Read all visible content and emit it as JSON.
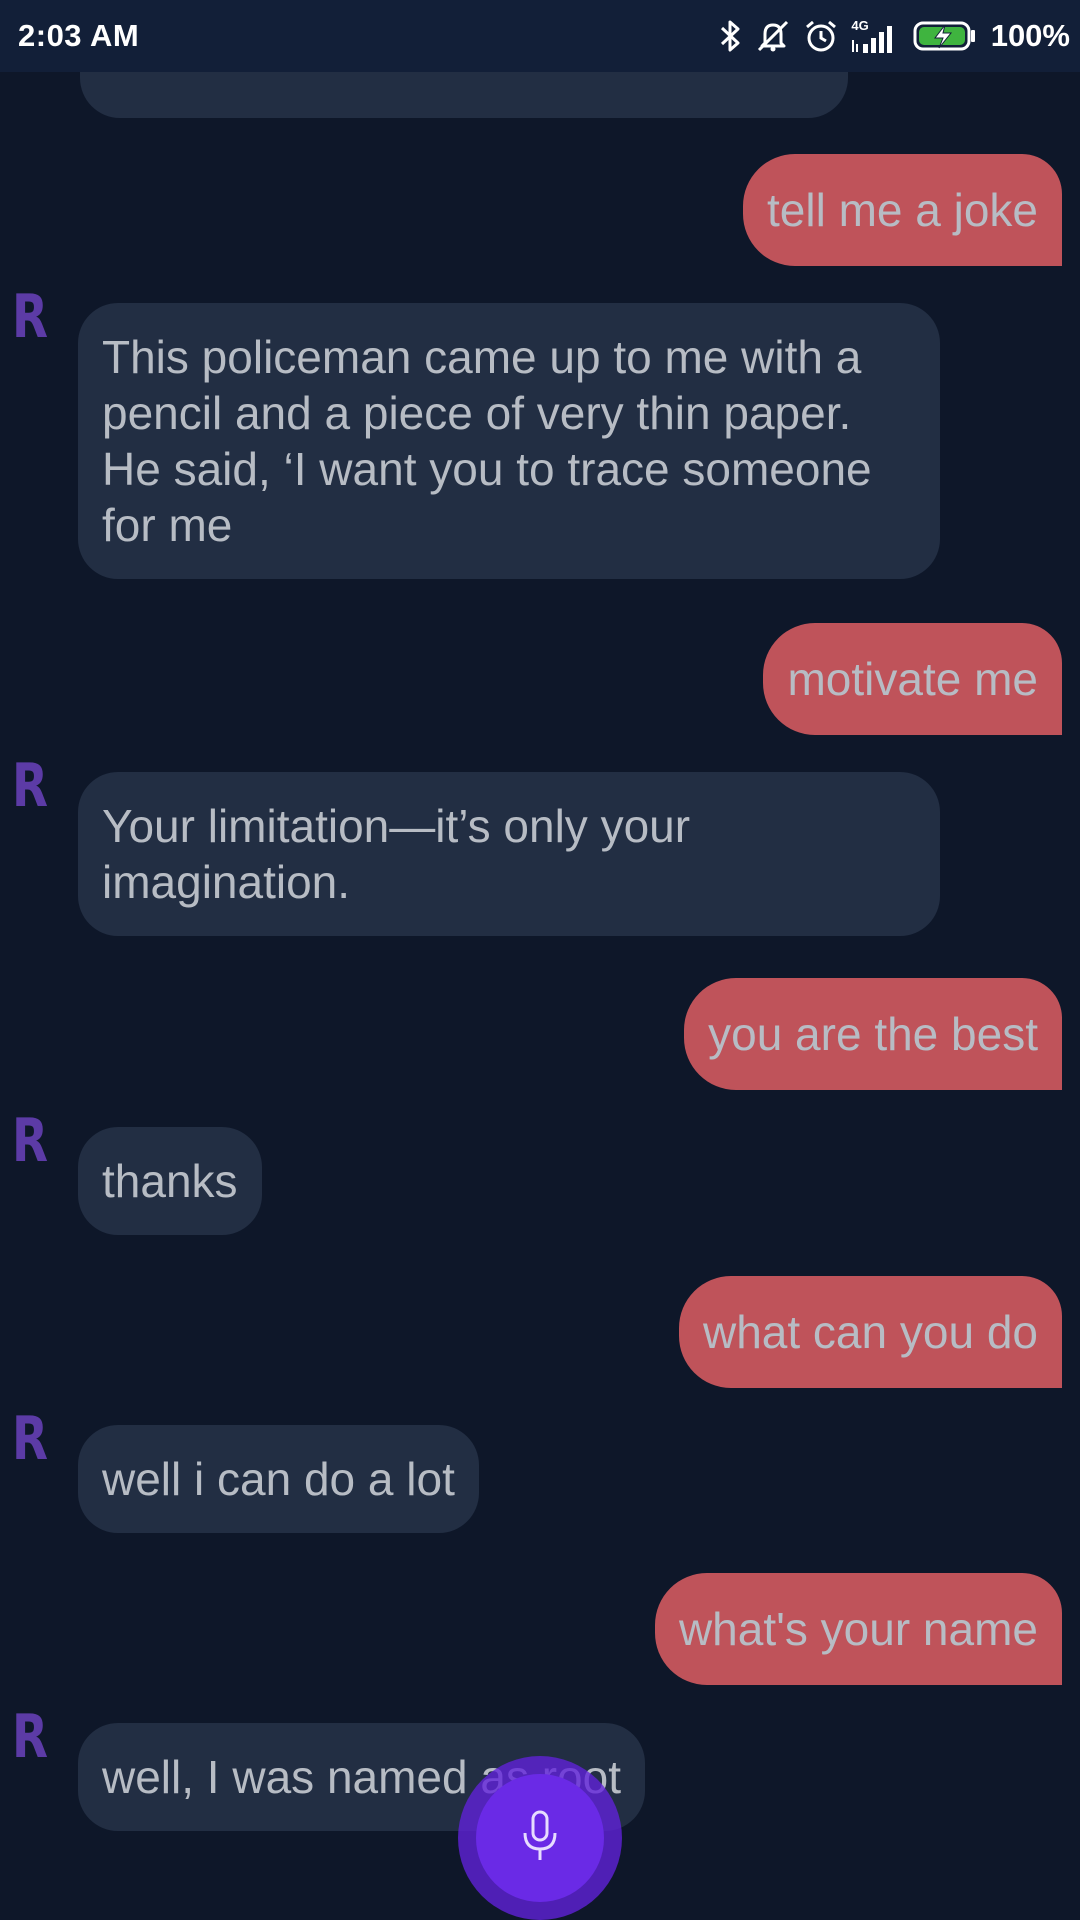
{
  "status_bar": {
    "time": "2:03 AM",
    "network": "4G",
    "battery": "100%",
    "icons": [
      "bluetooth-icon",
      "silent-bell-icon",
      "alarm-icon",
      "signal-icon",
      "battery-charging-icon"
    ]
  },
  "bot_avatar_letter": "R",
  "messages": [
    {
      "from": "user",
      "text": "tell me a joke"
    },
    {
      "from": "bot",
      "lines": [
        "This policeman came up to me with a",
        "pencil and a piece of very thin paper.",
        "He said, ‘I want you to trace someone",
        "for me"
      ]
    },
    {
      "from": "user",
      "text": "motivate me"
    },
    {
      "from": "bot",
      "lines": [
        "Your limitation—it’s only your",
        "imagination."
      ]
    },
    {
      "from": "user",
      "text": "you are the best"
    },
    {
      "from": "bot",
      "text": "thanks"
    },
    {
      "from": "user",
      "text": "what can you do"
    },
    {
      "from": "bot",
      "text": "well i can do a lot"
    },
    {
      "from": "user",
      "text": "what's your name"
    },
    {
      "from": "bot",
      "text": "well, I was named as root"
    }
  ],
  "colors": {
    "background": "#0e1729",
    "status_bar": "#121f38",
    "bot_bubble": "#222e43",
    "user_bubble": "#bf535a",
    "text": "#b7bcc4",
    "avatar": "#5c3ba6",
    "mic_button": "#6a2ae6"
  },
  "mic_button_icon": "microphone-icon"
}
